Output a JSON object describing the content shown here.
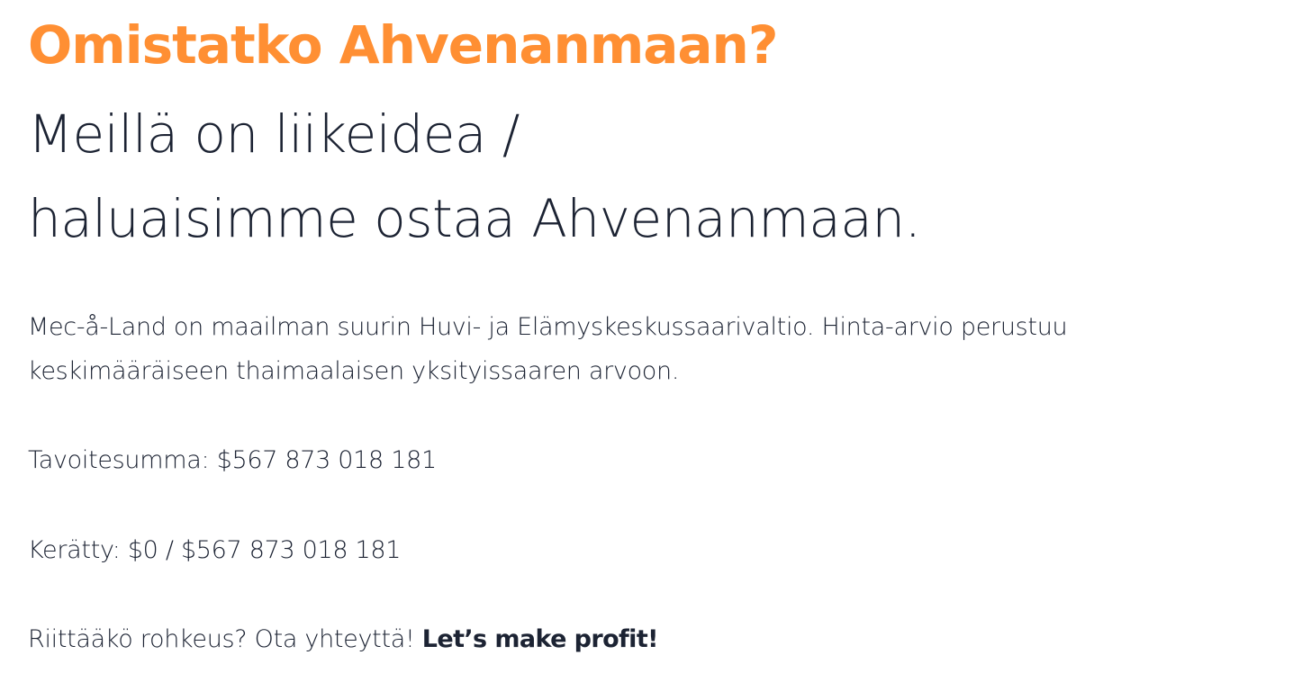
{
  "colors": {
    "accent": "#ff8f33",
    "text": "#1c2333",
    "background": "#ffffff"
  },
  "headline": "Omistatko Ahvenanmaan?",
  "subhead": {
    "line1": "Meillä on liikeidea /",
    "line2": "haluaisimme ostaa Ahvenanmaan."
  },
  "intro": {
    "line1": "Mec-å-Land on maailman suurin Huvi- ja Elämyskeskussaarivaltio. Hinta-arvio perustuu",
    "line2": "keskimääräiseen thaimaalaisen yksityissaaren arvoon."
  },
  "target_text": "Tavoitesumma: $567 873 018 181",
  "raised_text": "Kerätty: $0 / $567 873 018 181",
  "cta": {
    "text": "Riittääkö rohkeus? Ota yhteyttä! ",
    "strong": "Let’s make profit!"
  }
}
